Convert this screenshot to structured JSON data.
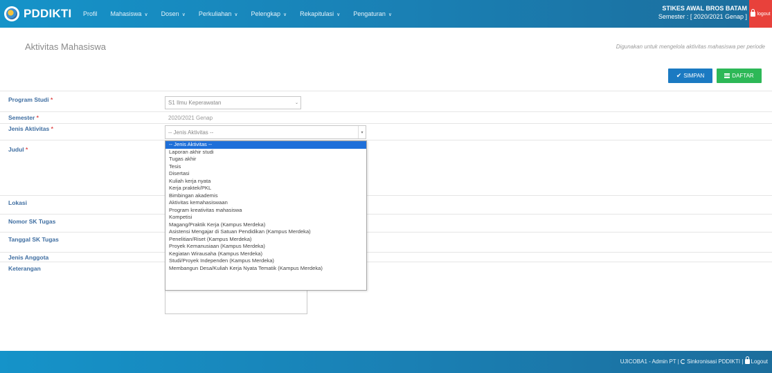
{
  "navbar": {
    "logo_text": "PDDIKTI",
    "items": [
      {
        "label": "Profil",
        "has_caret": false
      },
      {
        "label": "Mahasiswa",
        "has_caret": true
      },
      {
        "label": "Dosen",
        "has_caret": true
      },
      {
        "label": "Perkuliahan",
        "has_caret": true
      },
      {
        "label": "Pelengkap",
        "has_caret": true
      },
      {
        "label": "Rekapitulasi",
        "has_caret": true
      },
      {
        "label": "Pengaturan",
        "has_caret": true
      }
    ],
    "institution": "STIKES AWAL BROS BATAM",
    "semester": "Semester : [ 2020/2021 Genap ]",
    "logout_label": "logout"
  },
  "page": {
    "title": "Aktivitas Mahasiswa",
    "description": "Digunakan untuk mengelola aktivitas mahasiswa per periode",
    "save_label": "SIMPAN",
    "list_label": "DAFTAR"
  },
  "form": {
    "program_studi_label": "Program Studi",
    "program_studi_value": "S1 Ilmu Keperawatan",
    "semester_label": "Semester",
    "semester_value": "2020/2021 Genap",
    "jenis_aktivitas_label": "Jenis Aktivitas",
    "jenis_aktivitas_value": "-- Jenis Aktivitas --",
    "judul_label": "Judul",
    "lokasi_label": "Lokasi",
    "nomor_sk_label": "Nomor SK Tugas",
    "tanggal_sk_label": "Tanggal SK Tugas",
    "jenis_anggota_label": "Jenis Anggota",
    "keterangan_label": "Keterangan",
    "required_mark": "*"
  },
  "dropdown": {
    "options": [
      "-- Jenis Aktivitas --",
      "Laporan akhir studi",
      "Tugas akhir",
      "Tesis",
      "Disertasi",
      "Kuliah kerja nyata",
      "Kerja praktek/PKL",
      "Bimbingan akademis",
      "Aktivitas kemahasiswaan",
      "Program kreativitas mahasiswa",
      "Kompetisi",
      "Magang/Praktik Kerja (Kampus Merdeka)",
      "Asistensi Mengajar di Satuan Pendidikan (Kampus Merdeka)",
      "Penelitian/Riset (Kampus Merdeka)",
      "Proyek Kemanusiaan (Kampus Merdeka)",
      "Kegiatan Wirausaha (Kampus Merdeka)",
      "Studi/Proyek Independen (Kampus Merdeka)",
      "Membangun Desa/Kuliah Kerja Nyata Tematik (Kampus Merdeka)"
    ],
    "selected_index": 0
  },
  "footer": {
    "user_text": "UJICOBA1 - Admin PT |",
    "sync_text": "Sinkronisasi PDDIKTI |",
    "logout_text": "Logout"
  },
  "colors": {
    "navbar": "#1a7fb3",
    "logout_bg": "#e8413b",
    "save_btn": "#1b7ac2",
    "list_btn": "#2db857",
    "selected_option": "#1e6fd9"
  }
}
